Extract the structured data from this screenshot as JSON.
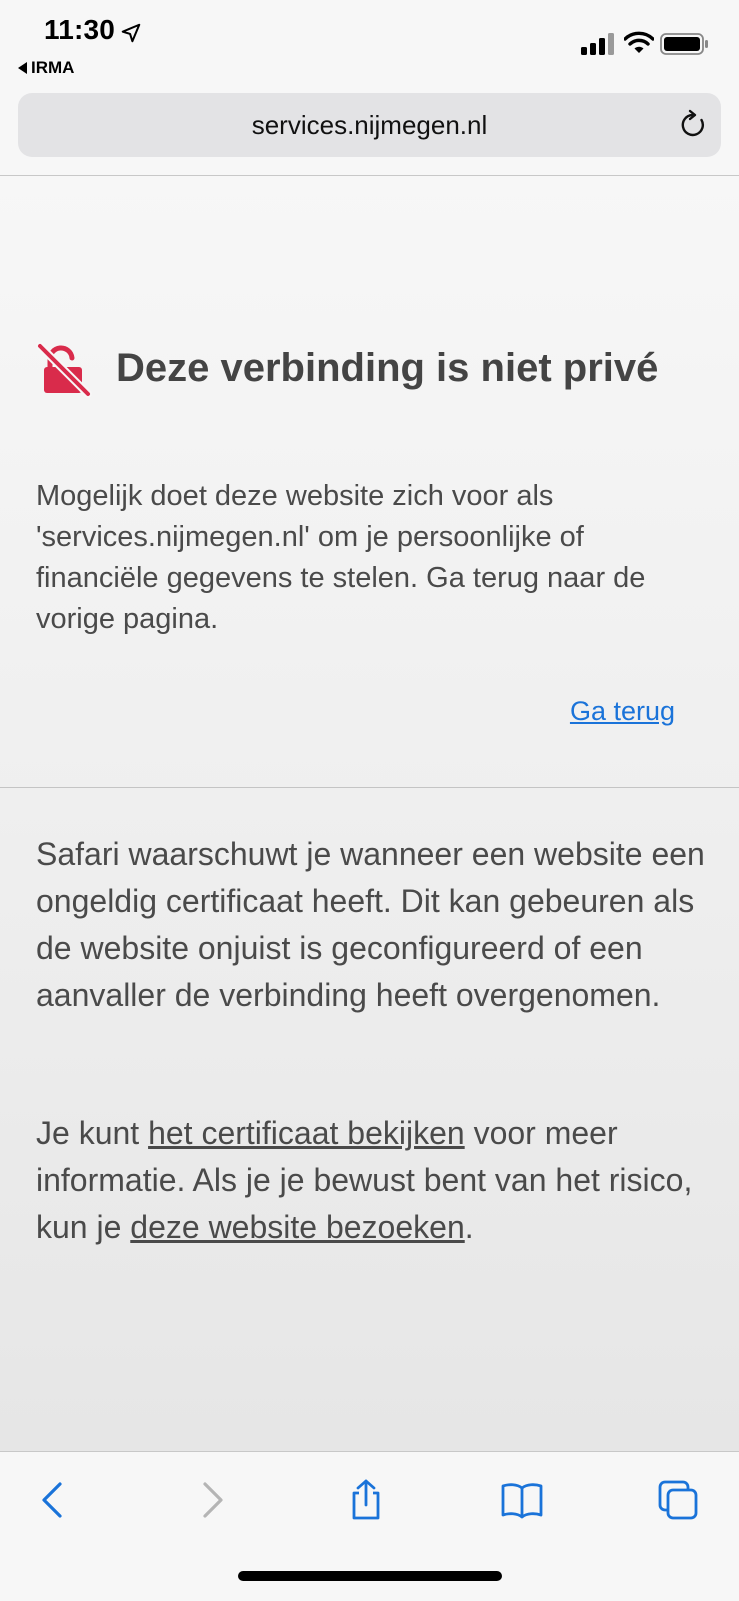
{
  "status_bar": {
    "time": "11:30",
    "back_app_label": "IRMA"
  },
  "url_bar": {
    "url": "services.nijmegen.nl"
  },
  "warning": {
    "title": "Deze verbinding is niet privé",
    "description": "Mogelijk doet deze website zich voor als 'services.nijmegen.nl' om je persoonlijke of financiële gegevens te stelen. Ga terug naar de vorige pagina.",
    "go_back_label": "Ga terug"
  },
  "details": {
    "paragraph1": "Safari waarschuwt je wanneer een website een ongeldig certificaat heeft. Dit kan gebeuren als de website onjuist is geconfigureerd of een aanvaller de verbinding heeft overgenomen.",
    "p2_prefix": "Je kunt ",
    "view_certificate_link": "het certificaat bekijken",
    "p2_middle": " voor meer informatie. Als je je bewust bent van het risico, kun je ",
    "visit_website_link": "deze website bezoeken",
    "p2_suffix": "."
  },
  "toolbar": {
    "icons": [
      "back-icon",
      "forward-icon",
      "share-icon",
      "bookmarks-icon",
      "tabs-icon"
    ]
  },
  "colors": {
    "accent": "#1a73d9",
    "warning_icon": "#d92b4b",
    "disabled": "#b5b5b5"
  }
}
